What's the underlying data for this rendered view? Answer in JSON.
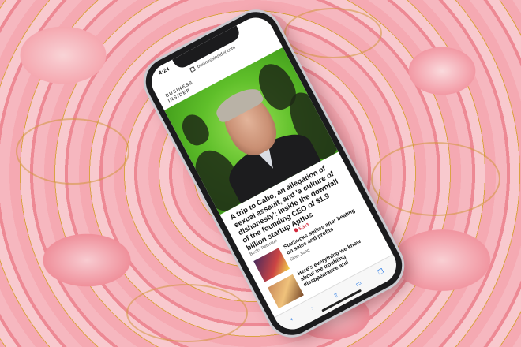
{
  "status": {
    "time": "4:24"
  },
  "browser": {
    "url": "businessinsider.com"
  },
  "brand": {
    "line1": "BUSINESS",
    "line2": "INSIDER"
  },
  "article": {
    "headline": "A trip to Cabo, an allegation of sexual assault, and 'a culture of dishonesty': Inside the downfall of the founding CEO of $1.9 billion startup Apttus",
    "author": "Becky Peterson",
    "views": "5,343"
  },
  "feed": [
    {
      "title": "Starbucks spikes after beating on sales and profits",
      "author": "Ethel Jiang"
    },
    {
      "title": "Here's everything we know about the troubling disappearance and",
      "author": ""
    }
  ],
  "toolbar": {
    "icons": [
      "back-icon",
      "forward-icon",
      "share-icon",
      "bookmarks-icon",
      "tabs-icon"
    ]
  }
}
